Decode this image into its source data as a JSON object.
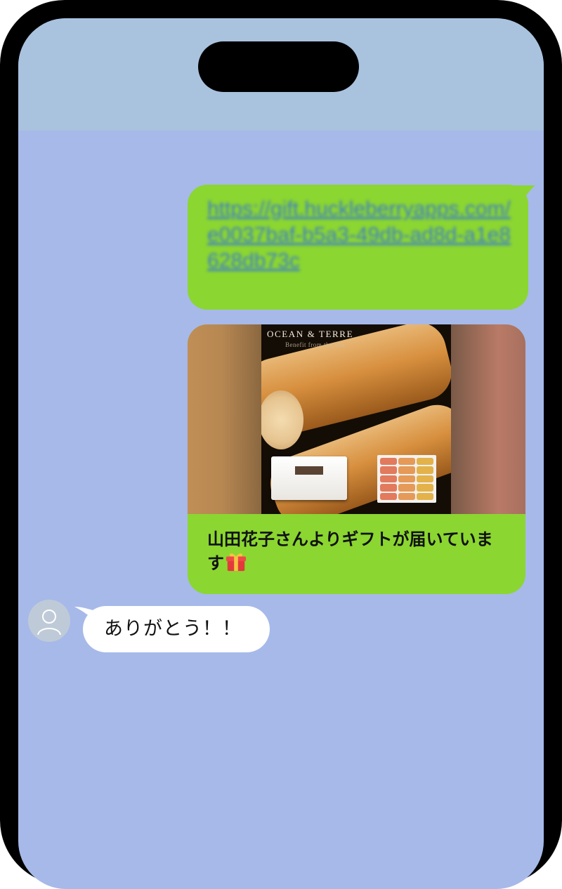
{
  "chat": {
    "link_message": "https://gift.huckleberryapps.com/e0037baf-b5a3-49db-ad8d-a1e8628db73c",
    "gift_card": {
      "image_brand": "OCEAN & TERRE",
      "image_subtitle": "Benefit from the Sea",
      "caption": "山田花子さんよりギフトが届いています",
      "emoji_icon": "gift-icon"
    },
    "reply_message": "ありがとう！！"
  },
  "colors": {
    "chat_background": "#a6b9e9",
    "status_area": "#a9c3df",
    "sent_bubble": "#8bd631",
    "received_bubble": "#ffffff",
    "link": "#3f7fc2"
  }
}
